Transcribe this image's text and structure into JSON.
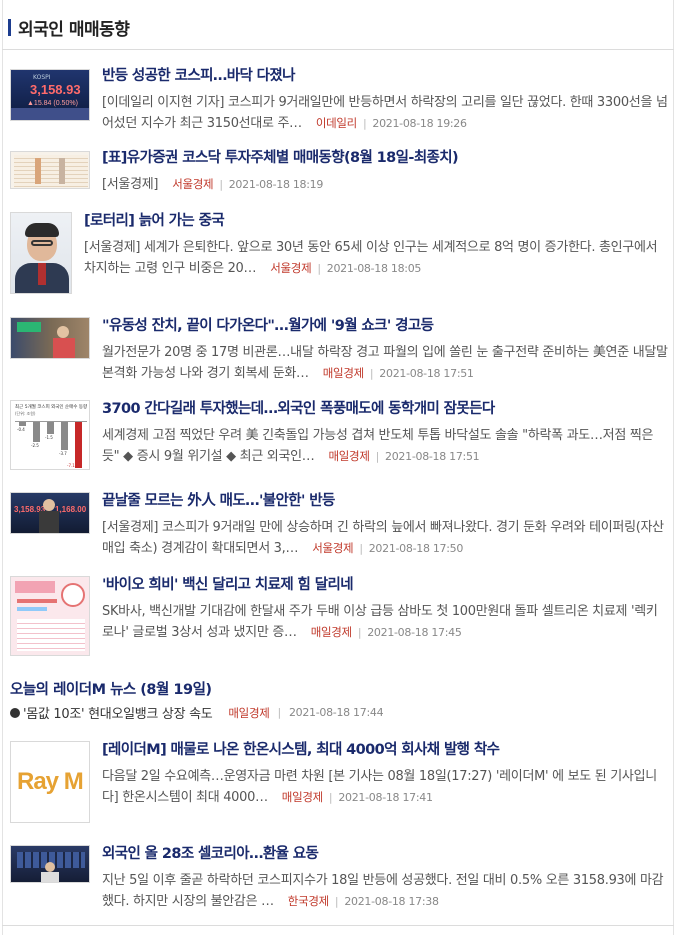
{
  "section": {
    "title": "외국인 매매동향"
  },
  "articles": [
    {
      "title": "반등 성공한 코스피…바닥 다졌나",
      "body": "[이데일리 이지현 기자] 코스피가 9거래일만에 반등하면서 하락장의 고리를 일단 끊었다. 한때 3300선을 넘어섰던 지수가 최근 3150선대로 주…",
      "source": "이데일리",
      "date": "2021-08-18 19:26",
      "thumb": {
        "line1": "KOSPI",
        "line2": "3,158.93",
        "line3": "▲15.84  (0.50%)"
      }
    },
    {
      "title": "[표]유가증권 코스닥 투자주체별 매매동향(8월 18일-최종치)",
      "body": "[서울경제]",
      "source": "서울경제",
      "date": "2021-08-18 18:19"
    },
    {
      "title": "[로터리] 늙어 가는 중국",
      "body": "[서울경제] 세계가 은퇴한다. 앞으로 30년 동안 65세 이상 인구는 세계적으로 8억 명이 증가한다. 총인구에서 차지하는 고령 인구 비중은 20…",
      "source": "서울경제",
      "date": "2021-08-18 18:05"
    },
    {
      "title": "\"유동성 잔치, 끝이 다가온다\"…월가에 '9월 쇼크' 경고등",
      "body": "월가전문가 20명 중 17명 비관론…내달 하락장 경고 파월의 입에 쏠린 눈 출구전략 준비하는 美연준 내달말 본격화 가능성 나와 경기 회복세 둔화…",
      "source": "매일경제",
      "date": "2021-08-18 17:51"
    },
    {
      "title": "3700 간다길래 투자했는데…외국인 폭풍매도에 동학개미 잠못든다",
      "body": "세계경제 고점 찍었단 우려 美 긴축돌입 가능성 겹쳐 반도체 투톱 바닥설도 솔솔 \"하락폭 과도…저점 찍은듯\" ◆ 증시 9월 위기설 ◆ 최근 외국인…",
      "source": "매일경제",
      "date": "2021-08-18 17:51",
      "thumb": {
        "heading": "최근 5개월 코스피 외국인 순매수 동향",
        "unit": "(단위: 조원)",
        "vals": [
          "-0.4",
          "-2.5",
          "-1.5",
          "-3.7",
          "-7.1"
        ]
      }
    },
    {
      "title": "끝날줄 모르는 外人 매도…'불안한' 반등",
      "body": "[서울경제] 코스피가 9거래일 만에 상승하며 긴 하락의 늪에서 빠져나왔다. 경기 둔화 우려와 테이퍼링(자산 매입 축소) 경계감이 확대되면서 3,…",
      "source": "서울경제",
      "date": "2021-08-18 17:50",
      "thumb": {
        "left": "3,158.93",
        "right": "1,168.00"
      }
    },
    {
      "title": "'바이오 희비' 백신 달리고 치료제 힘 달리네",
      "body": "SK바사, 백신개발 기대감에 한달새 주가 두배 이상 급등 삼바도 첫 100만원대 돌파 셀트리온 치료제 '렉키로나' 글로벌 3상서 성과 냈지만 증…",
      "source": "매일경제",
      "date": "2021-08-18 17:45"
    },
    {
      "title": "[레이더M] 매물로 나온 한온시스템, 최대 4000억 회사채 발행 착수",
      "body": "다음달 2일 수요예측…운영자금 마련 차원 [본 기사는 08월 18일(17:27) '레이더M' 에 보도 된 기사입니다] 한온시스템이 최대 4000…",
      "source": "매일경제",
      "date": "2021-08-18 17:41",
      "thumb": {
        "logo": "Ray M"
      }
    },
    {
      "title": "외국인 올 28조 셀코리아…환율 요동",
      "body": "지난 5일 이후 줄곧 하락하던 코스피지수가 18일 반등에 성공했다. 전일 대비 0.5% 오른 3158.93에 마감했다. 하지만 시장의 불안감은 …",
      "source": "한국경제",
      "date": "2021-08-18 17:38"
    }
  ],
  "mini": {
    "title": "오늘의 레이더M 뉴스 (8월 19일)",
    "item": "'몸값 10조' 현대오일뱅크 상장 속도",
    "source": "매일경제",
    "date": "2021-08-18 17:44"
  }
}
